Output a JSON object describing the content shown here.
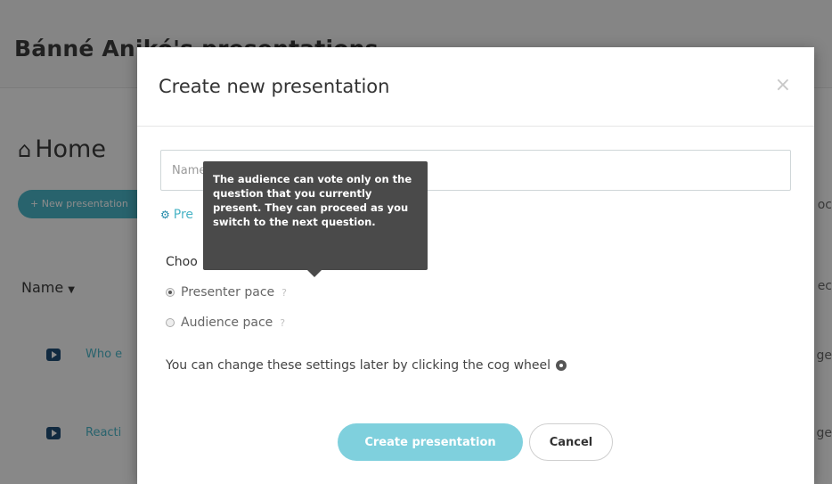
{
  "background": {
    "page_title": "Bánné Anikó's presentations",
    "home_label": "Home",
    "new_button_label": "+ New presentation",
    "sort_label": "Name",
    "rows": [
      {
        "title": "Who e"
      },
      {
        "title": "Reacti"
      }
    ],
    "right_fragments": [
      "oc",
      "ec",
      "ge",
      "ge"
    ]
  },
  "modal": {
    "title": "Create new presentation",
    "close_glyph": "×",
    "name_placeholder": "Name",
    "pres_link": "Pre",
    "choose_label": "Choo",
    "radio_options": [
      {
        "label": "Presenter pace",
        "checked": true
      },
      {
        "label": "Audience pace",
        "checked": false
      }
    ],
    "help_glyph": "?",
    "settings_note": "You can change these settings later by clicking the cog wheel",
    "create_button": "Create presentation",
    "cancel_button": "Cancel"
  },
  "tooltip": {
    "text": "The audience can vote only on the question that you currently present. They can proceed as you switch to the next question."
  },
  "colors": {
    "accent": "#4ab4c6",
    "button_primary": "#7fd0dd",
    "tooltip_bg": "#4a4a4a"
  }
}
